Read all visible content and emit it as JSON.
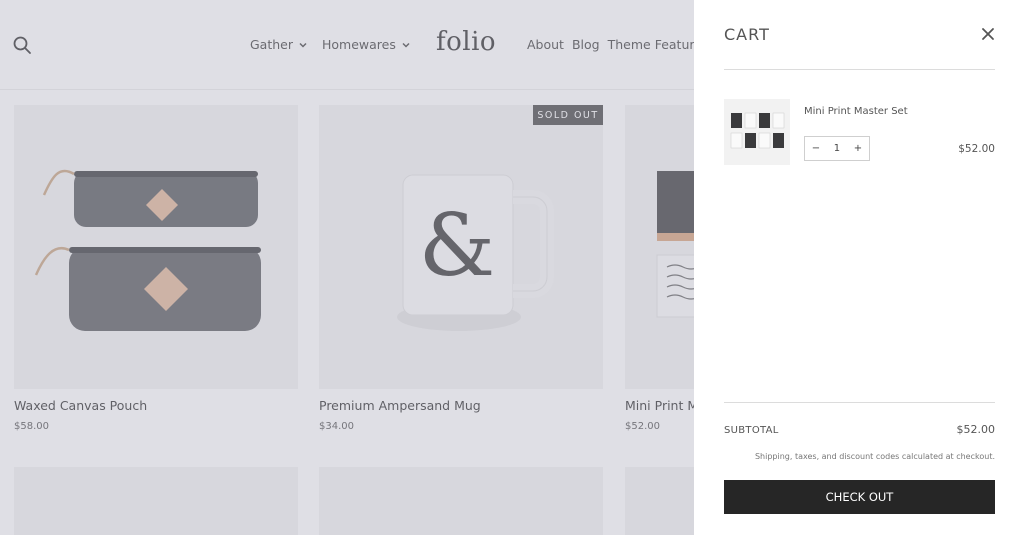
{
  "store": {
    "logo": "folio",
    "nav_left": [
      "Gather",
      "Homewares"
    ],
    "nav_right": [
      "About",
      "Blog",
      "Theme Feature"
    ],
    "sold_out_badge": "SOLD OUT",
    "products": [
      {
        "name": "Waxed Canvas Pouch",
        "price": "$58.00"
      },
      {
        "name": "Premium Ampersand Mug",
        "price": "$34.00"
      },
      {
        "name": "Mini Print M",
        "price": "$52.00"
      }
    ]
  },
  "cart": {
    "title": "CART",
    "item": {
      "name": "Mini Print Master Set",
      "quantity": "1",
      "minus": "−",
      "plus": "+",
      "price": "$52.00"
    },
    "subtotal_label": "SUBTOTAL",
    "subtotal_value": "$52.00",
    "shipping_note": "Shipping, taxes, and discount codes calculated at checkout.",
    "checkout_label": "CHECK OUT"
  },
  "icons": {
    "search": "search-icon",
    "close": "close-icon",
    "chevron": "chevron-down-icon"
  },
  "colors": {
    "checkout_bg": "#262626",
    "overlay": "#aaacba",
    "badge_bg": "#4b4b4b"
  }
}
